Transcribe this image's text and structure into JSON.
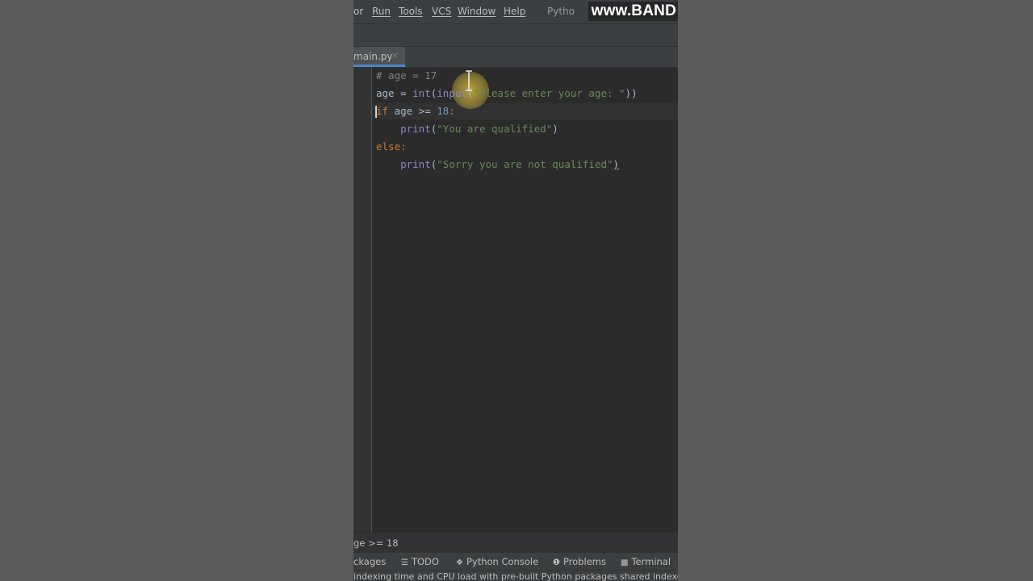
{
  "menu": {
    "items": [
      "or",
      "Run",
      "Tools",
      "VCS",
      "Window",
      "Help"
    ],
    "project_title": "Pytho"
  },
  "watermark": "www.BAND",
  "tab": {
    "label": "main.py",
    "close": "×"
  },
  "code": {
    "line1": {
      "comment": "# age = 17"
    },
    "line2": {
      "var": "age",
      "eq": " = ",
      "int": "int",
      "open": "(",
      "input": "input",
      "open2": "(",
      "str": "\"Please enter your age: \"",
      "close": "))"
    },
    "line3": {
      "if": "if",
      "rest": " age >= ",
      "num": "18",
      "colon": ":"
    },
    "line4": {
      "print": "print",
      "open": "(",
      "str": "\"You are qualified\"",
      "close": ")"
    },
    "line5": {
      "else": "else",
      "colon": ":"
    },
    "line6": {
      "print": "print",
      "open": "(",
      "str": "\"Sorry you are not qualified\"",
      "close": ")"
    }
  },
  "breadcrumb": "ge >= 18",
  "toolwindows": {
    "packages": "ckages",
    "todo": "TODO",
    "python_console": "Python Console",
    "problems": "Problems",
    "terminal": "Terminal"
  },
  "status": "indexing time and CPU load with pre-built Python packages shared indexes //"
}
